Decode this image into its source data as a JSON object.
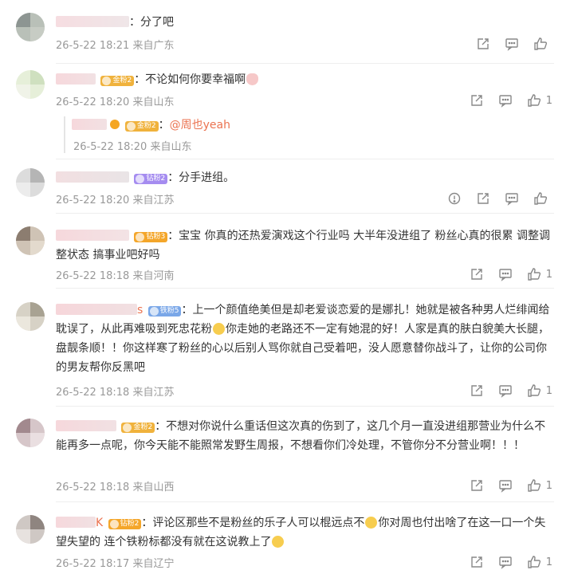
{
  "colors": {
    "mention": "#eb7350",
    "meta": "#999999",
    "text": "#333333"
  },
  "comments": [
    {
      "text": "：分了吧",
      "time": "26-5-22 18:21",
      "location": "来自广东",
      "likes": ""
    },
    {
      "badge": "金粉2",
      "text": "：不论如何你要幸福啊",
      "emoji": "heart-hands-emoji",
      "time": "26-5-22 18:20",
      "location": "来自山东",
      "likes": "1",
      "reply": {
        "badge": "金粉2",
        "mention": "@周也yeah",
        "sep": "：",
        "time": "26-5-22 18:20",
        "location": "来自山东"
      }
    },
    {
      "badge": "钻粉2",
      "text": "：分手进组。",
      "time": "26-5-22 18:20",
      "location": "来自江苏",
      "likes": ""
    },
    {
      "badge": "钻粉3",
      "text": "：宝宝 你真的还热爱演戏这个行业吗 大半年没进组了 粉丝心真的很累 调整调整状态 搞事业吧好吗",
      "time": "26-5-22 18:18",
      "location": "来自河南",
      "likes": "1"
    },
    {
      "name_tail": "s",
      "badge": "铁粉5",
      "text_a": "：上一个颜值绝美但是却老爱谈恋爱的是娜扎！她就是被各种男人烂绯闻给耽误了，从此再难吸到死忠花粉",
      "text_b": "你走她的老路还不一定有她混的好！人家是真的肤白貌美大长腿，盘靓条顺！！你这样寒了粉丝的心以后别人骂你就自己受着吧，没人愿意替你战斗了，让你的公司你的男友帮你反黑吧",
      "time": "26-5-22 18:18",
      "location": "来自江苏",
      "likes": "1"
    },
    {
      "badge": "金粉2",
      "text": "：不想对你说什么重话但这次真的伤到了，这几个月一直没进组那营业为什么不能再多一点呢，你今天能不能照常发野生周报，不想看你们冷处理，不管你分不分营业啊！！！",
      "time": "26-5-22 18:18",
      "location": "来自山西",
      "likes": "1"
    },
    {
      "name_tail": "K",
      "badge": "钻粉2",
      "text_a": "：评论区那些不是粉丝的乐子人可以棍远点不",
      "text_b": "你对周也付出啥了在这一口一个失望失望的 连个铁粉标都没有就在这说教上了",
      "time": "26-5-22 18:17",
      "location": "来自辽宁",
      "likes": "1"
    }
  ]
}
